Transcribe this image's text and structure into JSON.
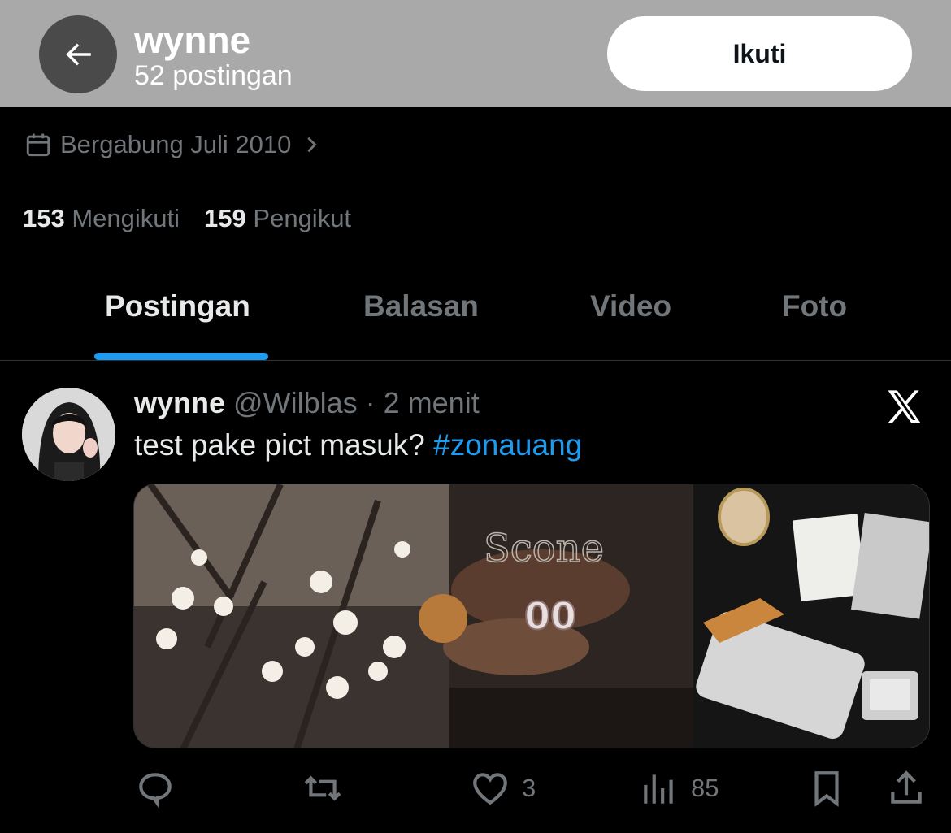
{
  "header": {
    "back_label": "back",
    "name": "wynne",
    "post_count": "52 postingan",
    "follow_label": "Ikuti"
  },
  "profile": {
    "joined": "Bergabung Juli 2010",
    "following_count": "153",
    "following_label": "Mengikuti",
    "followers_count": "159",
    "followers_label": "Pengikut"
  },
  "tabs": [
    {
      "label": "Postingan",
      "active": true
    },
    {
      "label": "Balasan",
      "active": false
    },
    {
      "label": "Video",
      "active": false
    },
    {
      "label": "Foto",
      "active": false
    }
  ],
  "post": {
    "display_name": "wynne",
    "handle": "@Wilblas",
    "separator": "·",
    "time": "2 menit",
    "text": "test pake pict masuk?",
    "hashtag": "#zonauang",
    "media_description": "",
    "actions": {
      "reply_count": "",
      "repost_count": "",
      "like_count": "3",
      "views_count": "85"
    }
  },
  "colors": {
    "accent": "#1d9bf0",
    "background": "#000000",
    "header_bg": "#a9a9a9",
    "muted_text": "#71767b"
  },
  "icons": [
    "back-arrow-icon",
    "calendar-icon",
    "chevron-right-icon",
    "x-logo-icon",
    "reply-icon",
    "repost-icon",
    "like-icon",
    "views-icon",
    "bookmark-icon",
    "share-icon"
  ]
}
